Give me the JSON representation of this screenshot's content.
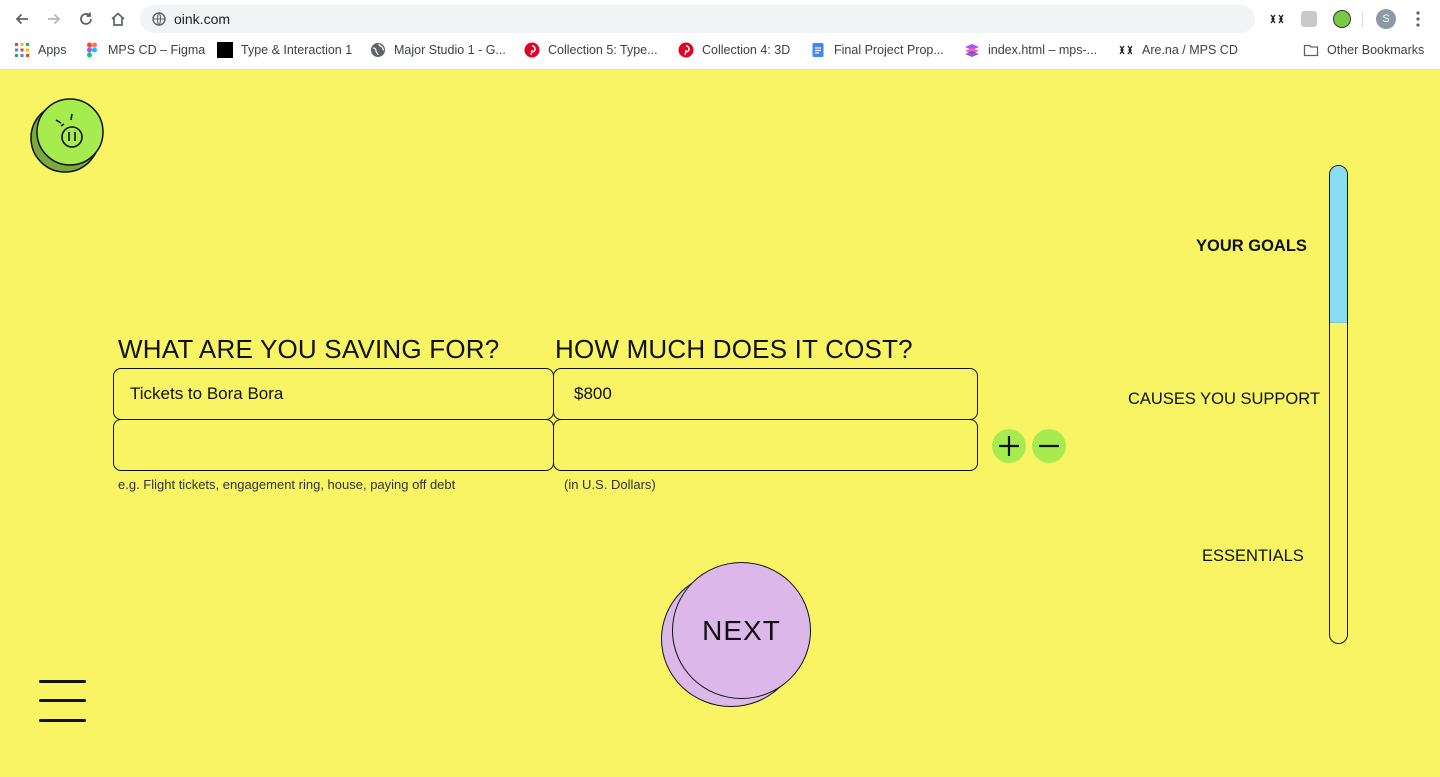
{
  "browser": {
    "url": "oink.com",
    "profile_initial": "S",
    "bookmarks": [
      {
        "label": "Apps",
        "icon": "apps-grid-icon"
      },
      {
        "label": "MPS CD – Figma",
        "icon": "figma-icon"
      },
      {
        "label": "Type & Interaction 1",
        "icon": "black-square-icon"
      },
      {
        "label": "Major Studio 1 - G...",
        "icon": "globe-icon"
      },
      {
        "label": "Collection 5: Type...",
        "icon": "pinterest-icon"
      },
      {
        "label": "Collection 4: 3D",
        "icon": "pinterest-icon"
      },
      {
        "label": "Final Project Prop...",
        "icon": "docs-icon"
      },
      {
        "label": "index.html – mps-...",
        "icon": "glitch-icon"
      },
      {
        "label": "Are.na / MPS CD",
        "icon": "arena-icon"
      },
      {
        "label": "Other Bookmarks",
        "icon": "folder-icon"
      }
    ]
  },
  "form": {
    "saving_heading": "WHAT ARE YOU SAVING FOR?",
    "cost_heading": "HOW MUCH DOES IT COST?",
    "goal_1": "Tickets to Bora Bora",
    "cost_1": "$800",
    "goal_2": "",
    "cost_2": "",
    "saving_hint": "e.g. Flight tickets, engagement ring, house, paying off debt",
    "cost_hint": "(in U.S. Dollars)"
  },
  "next_label": "NEXT",
  "steps": [
    {
      "label": "YOUR GOALS",
      "active": true
    },
    {
      "label": "CAUSES YOU SUPPORT",
      "active": false
    },
    {
      "label": "ESSENTIALS",
      "active": false
    }
  ],
  "progress_fraction": 0.33,
  "colors": {
    "background": "#f8f463",
    "accent_green": "#a6ec4f",
    "next_purple": "#dcb8ea",
    "progress_blue": "#88ddf3"
  }
}
